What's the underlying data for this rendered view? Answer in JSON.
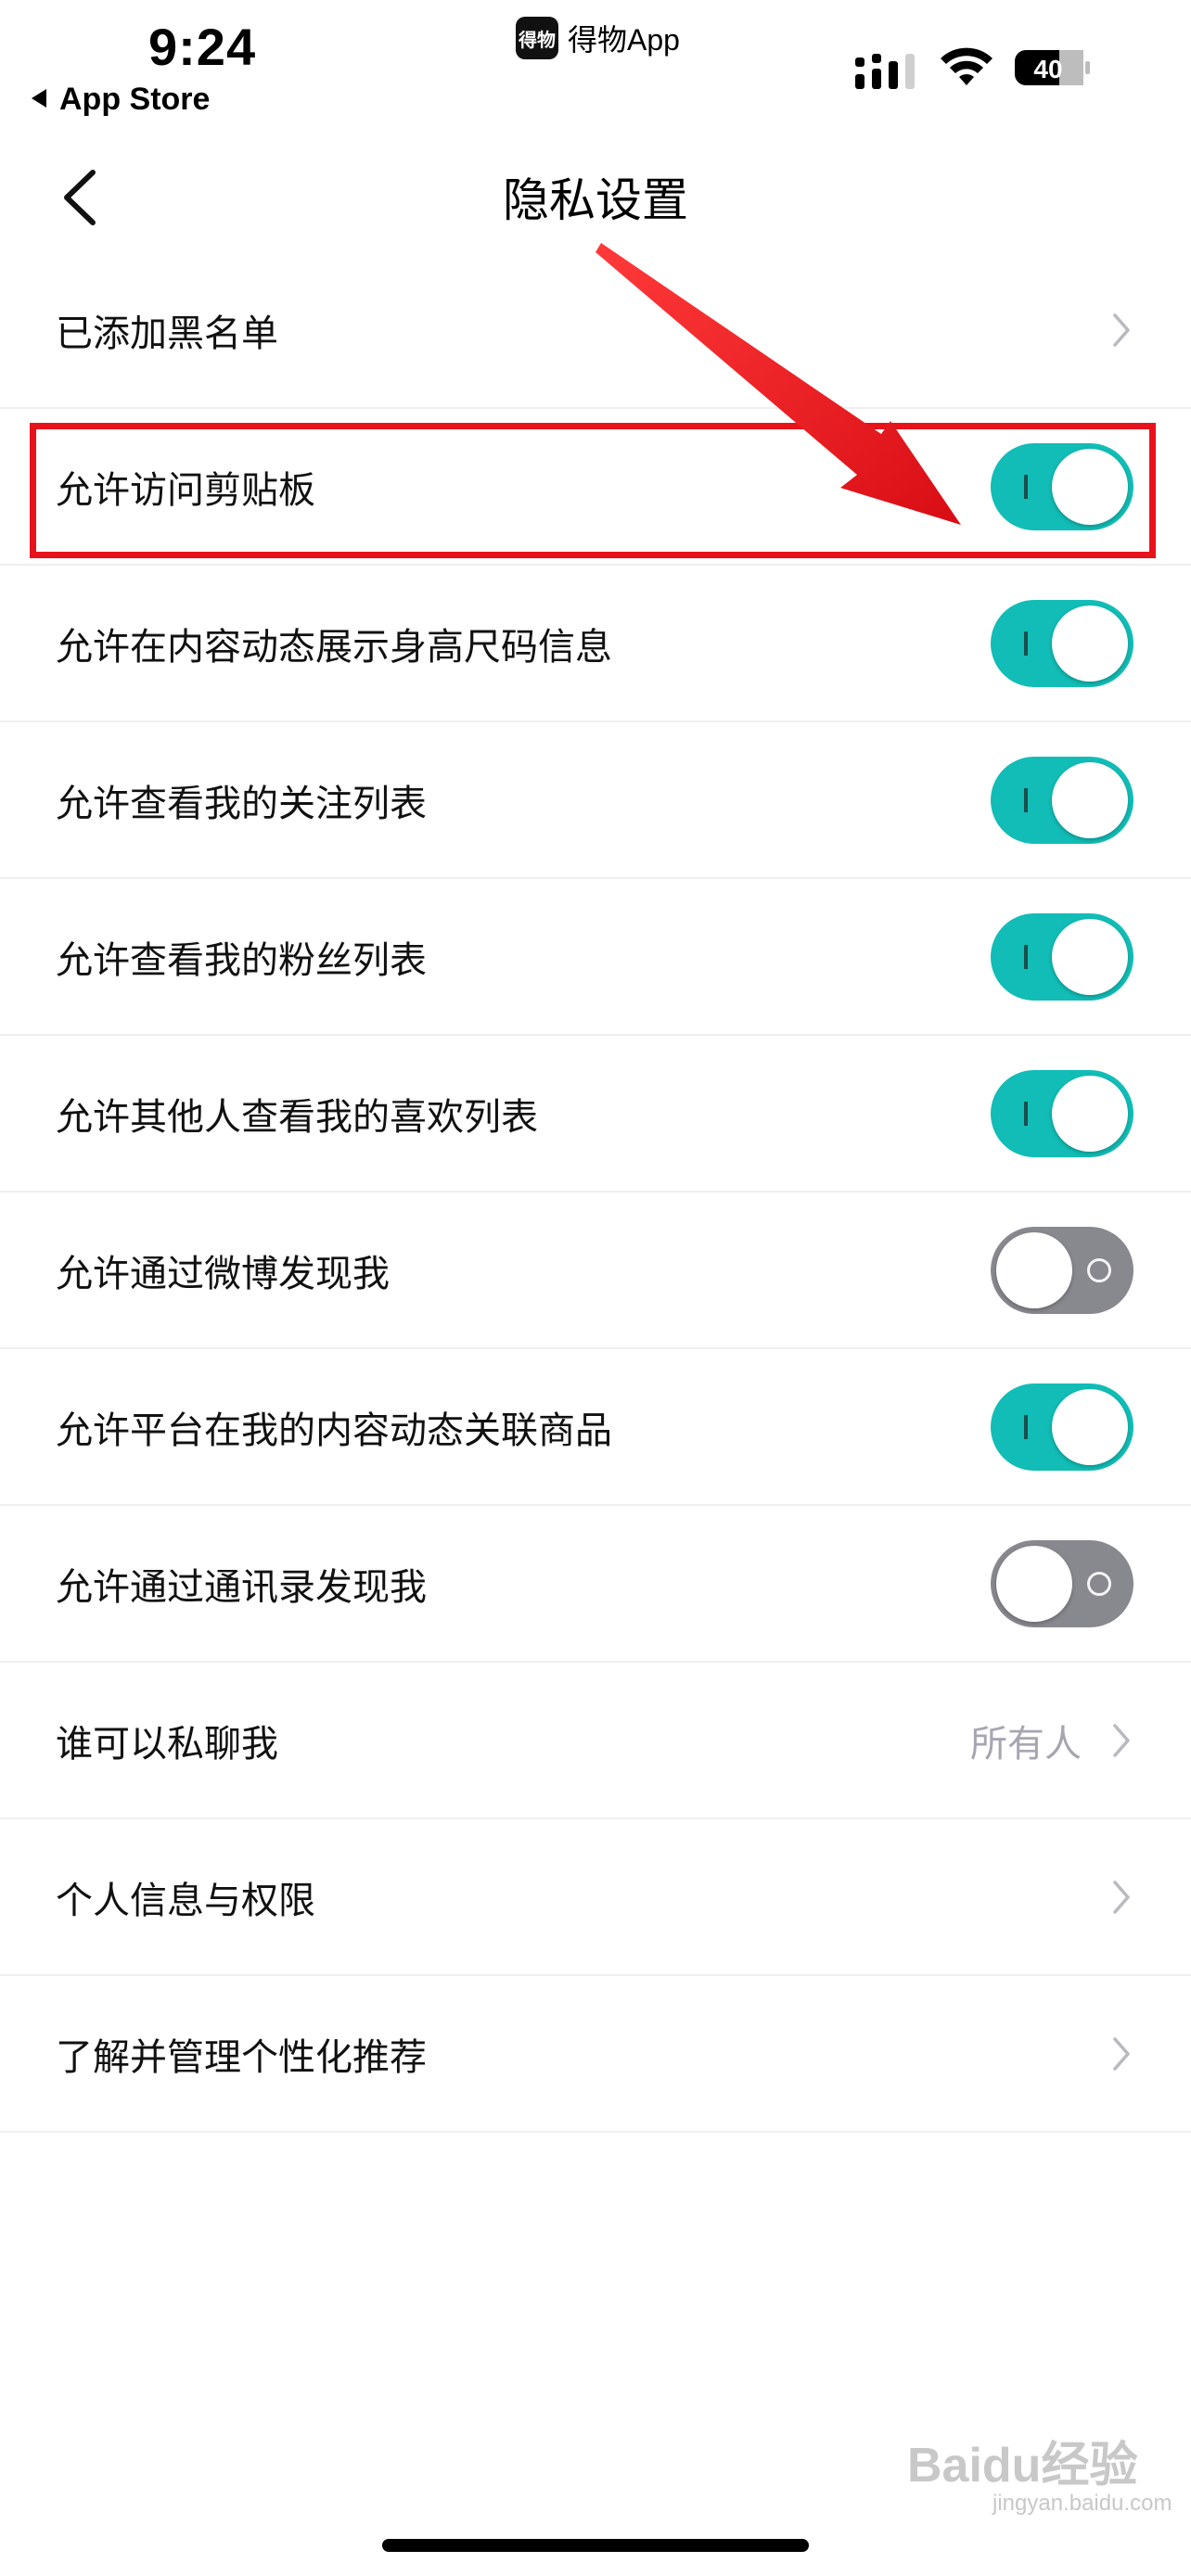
{
  "status_bar": {
    "time": "9:24",
    "back_app": "App Store",
    "island_badge": "得物",
    "island_label": "得物App",
    "battery": "40"
  },
  "nav": {
    "title": "隐私设置"
  },
  "rows": [
    {
      "label": "已添加黑名单",
      "type": "chevron"
    },
    {
      "label": "允许访问剪贴板",
      "type": "toggle",
      "on": true
    },
    {
      "label": "允许在内容动态展示身高尺码信息",
      "type": "toggle",
      "on": true
    },
    {
      "label": "允许查看我的关注列表",
      "type": "toggle",
      "on": true
    },
    {
      "label": "允许查看我的粉丝列表",
      "type": "toggle",
      "on": true
    },
    {
      "label": "允许其他人查看我的喜欢列表",
      "type": "toggle",
      "on": true
    },
    {
      "label": "允许通过微博发现我",
      "type": "toggle",
      "on": false
    },
    {
      "label": "允许平台在我的内容动态关联商品",
      "type": "toggle",
      "on": true
    },
    {
      "label": "允许通过通讯录发现我",
      "type": "toggle",
      "on": false
    },
    {
      "label": "谁可以私聊我",
      "type": "chevron",
      "value": "所有人"
    },
    {
      "label": "个人信息与权限",
      "type": "chevron"
    },
    {
      "label": "了解并管理个性化推荐",
      "type": "chevron"
    }
  ],
  "colors": {
    "toggle_on": "#11bdb6",
    "toggle_off": "#88888f",
    "annotation_red": "#e8121b"
  },
  "watermark": {
    "main": "Baidu经验",
    "sub": "jingyan.baidu.com"
  }
}
